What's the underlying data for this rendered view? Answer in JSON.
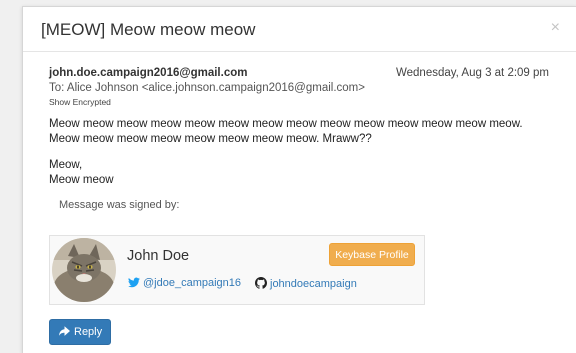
{
  "modal": {
    "title": "[MEOW] Meow meow meow",
    "close": "×"
  },
  "email": {
    "from": "john.doe.campaign2016@gmail.com",
    "date": "Wednesday, Aug 3 at 2:09 pm",
    "to": "To: Alice Johnson <alice.johnson.campaign2016@gmail.com>",
    "show_encrypted": "Show Encrypted",
    "paragraphs": [
      "Meow meow meow meow meow meow meow meow meow meow meow meow meow meow. Meow meow meow meow meow meow meow meow. Mraww??",
      "Meow,",
      "Meow meow"
    ],
    "signed_label": "Message was signed by:"
  },
  "signer": {
    "name": "John Doe",
    "keybase_button": "Keybase Profile",
    "twitter": "@jdoe_campaign16",
    "github": "johndoecampaign"
  },
  "actions": {
    "reply": "Reply"
  },
  "colors": {
    "primary": "#337ab7",
    "warning": "#f0ad4e",
    "twitter": "#1da1f2"
  }
}
